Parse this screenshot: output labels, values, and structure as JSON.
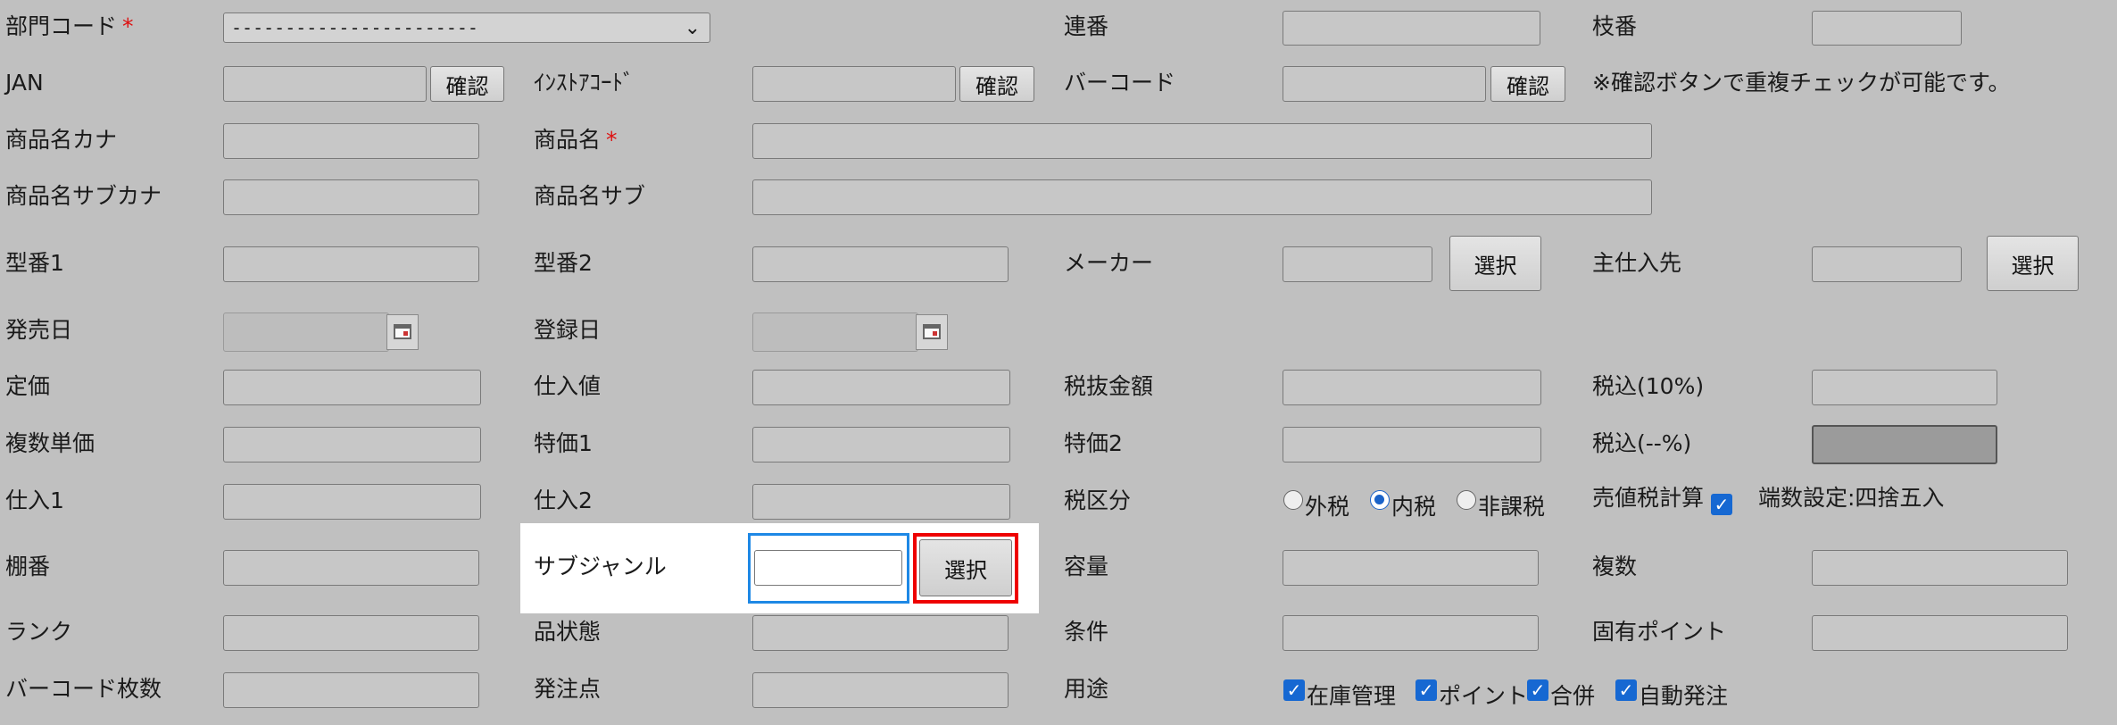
{
  "form": {
    "dept": {
      "label": "部門コード",
      "required_mark": "*",
      "value": "-----------------------"
    },
    "serial": {
      "label": "連番"
    },
    "branch": {
      "label": "枝番"
    },
    "jan": {
      "label": "JAN",
      "button": "確認"
    },
    "instore": {
      "label": "ｲﾝｽﾄｱｺｰﾄﾞ",
      "button": "確認"
    },
    "barcode": {
      "label": "バーコード",
      "button": "確認"
    },
    "confirm_note": "※確認ボタンで重複チェックが可能です。",
    "name_kana": {
      "label": "商品名カナ"
    },
    "name": {
      "label": "商品名",
      "required_mark": "*"
    },
    "sub_kana": {
      "label": "商品名サブカナ"
    },
    "sub_name": {
      "label": "商品名サブ"
    },
    "model1": {
      "label": "型番1"
    },
    "model2": {
      "label": "型番2"
    },
    "maker": {
      "label": "メーカー",
      "button": "選択"
    },
    "supplier": {
      "label": "主仕入先",
      "button": "選択"
    },
    "release_date": {
      "label": "発売日"
    },
    "reg_date": {
      "label": "登録日"
    },
    "list_price": {
      "label": "定価"
    },
    "cost": {
      "label": "仕入値"
    },
    "excl_tax": {
      "label": "税抜金額"
    },
    "incl10": {
      "label": "税込(10%)"
    },
    "multi_unit": {
      "label": "複数単価"
    },
    "special1": {
      "label": "特価1"
    },
    "special2": {
      "label": "特価2"
    },
    "incl_other": {
      "label": "税込(--%)"
    },
    "purchase1": {
      "label": "仕入1"
    },
    "purchase2": {
      "label": "仕入2"
    },
    "tax_class": {
      "label": "税区分",
      "options": [
        "外税",
        "内税",
        "非課税"
      ],
      "selected": "内税"
    },
    "sell_tax_calc": {
      "label": "売値税計算",
      "checked": true
    },
    "rounding": "端数設定:四捨五入",
    "shelf": {
      "label": "棚番"
    },
    "subgenre": {
      "label": "サブジャンル",
      "button": "選択"
    },
    "capacity": {
      "label": "容量"
    },
    "multiple": {
      "label": "複数"
    },
    "rank": {
      "label": "ランク"
    },
    "condition": {
      "label": "品状態"
    },
    "terms": {
      "label": "条件"
    },
    "points": {
      "label": "固有ポイント"
    },
    "barcode_count": {
      "label": "バーコード枚数"
    },
    "reorder": {
      "label": "発注点"
    },
    "usage": {
      "label": "用途",
      "options": [
        "在庫管理",
        "ポイント",
        "合併",
        "自動発注"
      ]
    }
  }
}
